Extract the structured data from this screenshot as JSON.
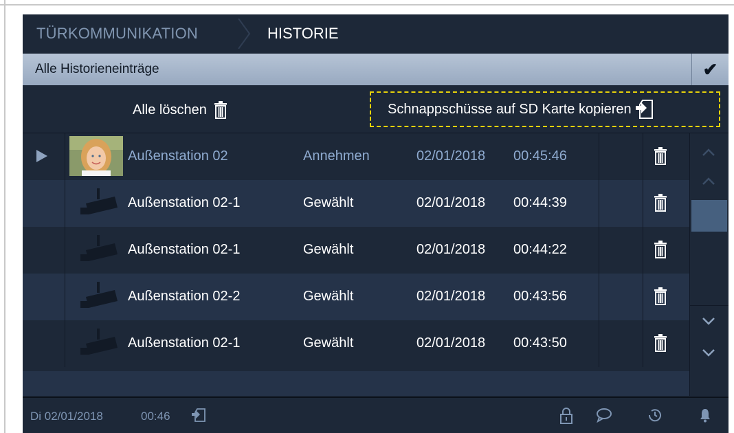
{
  "header": {
    "breadcrumb_parent": "TÜRKOMMUNIKATION",
    "breadcrumb_current": "HISTORIE"
  },
  "filter": {
    "label": "Alle Historieneinträge",
    "confirm_icon": "checkmark-icon"
  },
  "actions": {
    "delete_all_label": "Alle löschen",
    "delete_all_icon": "trash-icon",
    "copy_sd_label": "Schnappschüsse auf SD Karte kopieren",
    "copy_sd_icon": "sd-card-export-icon"
  },
  "entries": [
    {
      "name": "Außenstation 02",
      "status": "Annehmen",
      "date": "02/01/2018",
      "time": "00:45:46",
      "thumbnail": "snapshot-child-photo"
    },
    {
      "name": "Außenstation 02-1",
      "status": "Gewählt",
      "date": "02/01/2018",
      "time": "00:44:39",
      "thumbnail": "camera-icon"
    },
    {
      "name": "Außenstation 02-1",
      "status": "Gewählt",
      "date": "02/01/2018",
      "time": "00:44:22",
      "thumbnail": "camera-icon"
    },
    {
      "name": "Außenstation 02-2",
      "status": "Gewählt",
      "date": "02/01/2018",
      "time": "00:43:56",
      "thumbnail": "camera-icon"
    },
    {
      "name": "Außenstation 02-1",
      "status": "Gewählt",
      "date": "02/01/2018",
      "time": "00:43:50",
      "thumbnail": "camera-icon"
    }
  ],
  "statusbar": {
    "date": "Di 02/01/2018",
    "time": "00:46",
    "icons": [
      "sd-card-icon",
      "lock-icon",
      "message-icon",
      "history-icon",
      "bell-icon"
    ]
  },
  "colors": {
    "background": "#1d2838",
    "row_alt": "#253349",
    "filter_bar": "#a7b7cc",
    "accent_text": "#8fabd0",
    "highlight_dash": "#e6d20a"
  }
}
